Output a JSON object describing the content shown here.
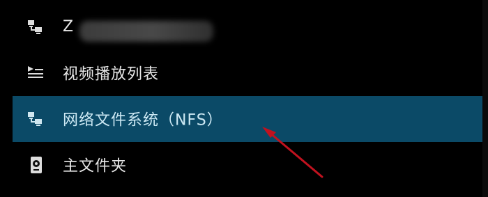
{
  "menu": {
    "items": [
      {
        "label": "Z",
        "icon": "network-computer-icon",
        "state": "partially-visible"
      },
      {
        "label": "视频播放列表",
        "icon": "playlist-icon",
        "state": "normal"
      },
      {
        "label": "网络文件系统（NFS）",
        "icon": "network-computer-icon",
        "state": "selected"
      },
      {
        "label": "主文件夹",
        "icon": "hard-drive-icon",
        "state": "normal"
      }
    ]
  },
  "colors": {
    "background": "#000000",
    "selection": "#0b4a67",
    "text": "#e7e7e7",
    "selected_text": "#cde9f4",
    "annotation_arrow": "#c1121f"
  }
}
